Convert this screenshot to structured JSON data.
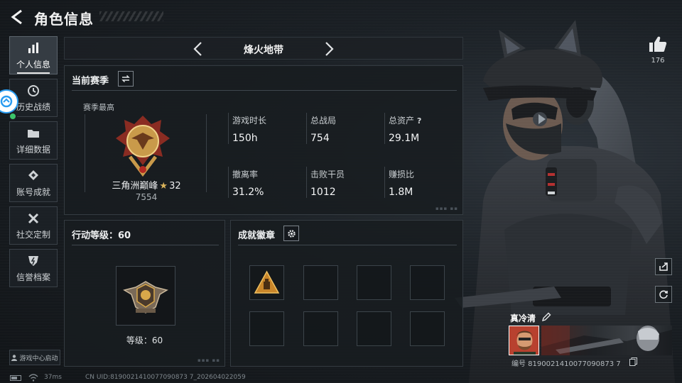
{
  "header": {
    "title": "角色信息"
  },
  "sidebar": {
    "items": [
      {
        "label": "个人信息",
        "icon": "bar-chart-icon",
        "active": true
      },
      {
        "label": "历史战绩",
        "icon": "clock-icon",
        "active": false
      },
      {
        "label": "详细数据",
        "icon": "folder-icon",
        "active": false
      },
      {
        "label": "账号成就",
        "icon": "medal-icon",
        "active": false
      },
      {
        "label": "社交定制",
        "icon": "tools-icon",
        "active": false
      },
      {
        "label": "信誉档案",
        "icon": "shield-icon",
        "active": false
      }
    ],
    "game_center": "游戏中心启动"
  },
  "mode": {
    "title": "烽火地带"
  },
  "season": {
    "title": "当前赛季",
    "best_label": "赛季最高",
    "rank_name": "三角洲巅峰",
    "rank_stars": "32",
    "rank_score": "7554",
    "stats": [
      {
        "label": "游戏时长",
        "value": "150h"
      },
      {
        "label": "总战局",
        "value": "754"
      },
      {
        "label": "总资产",
        "value": "29.1M",
        "help": "?"
      },
      {
        "label": "撤离率",
        "value": "31.2%"
      },
      {
        "label": "击败干员",
        "value": "1012"
      },
      {
        "label": "赚损比",
        "value": "1.8M"
      }
    ]
  },
  "level": {
    "title": "行动等级：60",
    "caption": "等级：60"
  },
  "achievements": {
    "title": "成就徽章",
    "slots": 8,
    "filled": 1
  },
  "social": {
    "likes": "176"
  },
  "player": {
    "name": "真冷清",
    "id_text": "编号 8190021410077090873 7"
  },
  "footer": {
    "ping": "37ms",
    "uid": "CN UID:8190021410077090873 7_202604022059"
  },
  "colors": {
    "accent": "#d9b35a",
    "panel": "#181c20",
    "border": "#343b41"
  }
}
